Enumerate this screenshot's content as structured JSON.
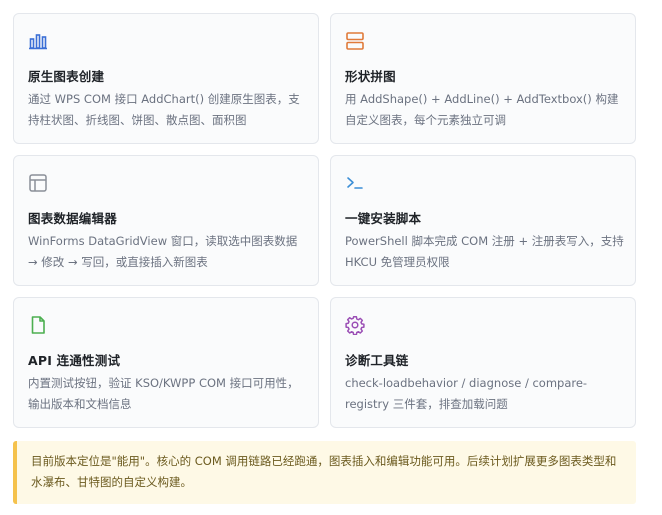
{
  "cards": [
    {
      "icon": "bar-chart-icon",
      "title": "原生图表创建",
      "desc": "通过 WPS COM 接口 AddChart() 创建原生图表，支持柱状图、折线图、饼图、散点图、面积图",
      "color": "#3b6fd6"
    },
    {
      "icon": "shapes-icon",
      "title": "形状拼图",
      "desc": "用 AddShape() + AddLine() + AddTextbox() 构建自定义图表，每个元素独立可调",
      "color": "#e07a3a"
    },
    {
      "icon": "table-icon",
      "title": "图表数据编辑器",
      "desc": "WinForms DataGridView 窗口，读取选中图表数据 → 修改 → 写回，或直接插入新图表",
      "color": "#8a8f98"
    },
    {
      "icon": "terminal-icon",
      "title": "一键安装脚本",
      "desc": "PowerShell 脚本完成 COM 注册 + 注册表写入，支持 HKCU 免管理员权限",
      "color": "#3b8ed6"
    },
    {
      "icon": "file-icon",
      "title": "API 连通性测试",
      "desc": "内置测试按钮，验证 KSO/KWPP COM 接口可用性，输出版本和文档信息",
      "color": "#4caf50"
    },
    {
      "icon": "gear-icon",
      "title": "诊断工具链",
      "desc": "check-loadbehavior / diagnose / compare-registry 三件套，排查加载问题",
      "color": "#9b4fb5"
    }
  ],
  "note": {
    "text": "目前版本定位是\"能用\"。核心的 COM 调用链路已经跑通，图表插入和编辑功能可用。后续计划扩展更多图表类型和水瀑布、甘特图的自定义构建。",
    "border_color": "#f5c24c",
    "bg_color": "#fef9e6"
  }
}
